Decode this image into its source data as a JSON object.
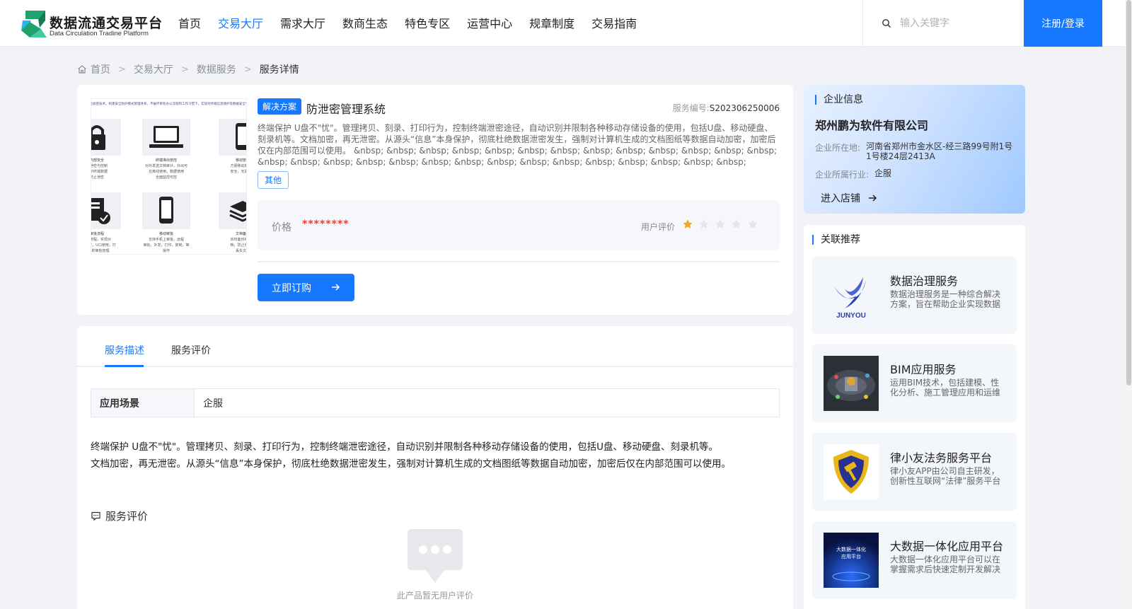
{
  "header": {
    "logo_cn": "数据流通交易平台",
    "logo_en": "Data Circulation Tradine Platform",
    "nav": [
      "首页",
      "交易大厅",
      "需求大厅",
      "数商生态",
      "特色专区",
      "运营中心",
      "规章制度",
      "交易指南"
    ],
    "active_nav": "交易大厅",
    "search_placeholder": "输入关键字",
    "login_label": "注册/登录",
    "accent_color": "#1677ff"
  },
  "breadcrumb": [
    "首页",
    "交易大厅",
    "数据服务",
    "服务详情"
  ],
  "product": {
    "tag": "解决方案",
    "title": "防泄密管理系统",
    "service_no_label": "服务编号:",
    "service_no": "S202306250006",
    "description": "终端保护 U盘不\"忧\"。管理拷贝、刻录、打印行为，控制终端泄密途径，自动识别并限制各种移动存储设备的使用，包括U盘、移动硬盘、刻录机等。文档加密，再无泄密。从源头“信息”本身保护，彻底杜绝数据泄密发生，强制对计算机生成的文档图纸等数据自动加密，加密后仅在内部范围可以使用。 &nbsp; &nbsp; &nbsp; &nbsp; &nbsp; &nbsp; &nbsp; &nbsp; &nbsp; &nbsp; &nbsp; &nbsp; &nbsp; &nbsp; &nbsp; &nbsp; &nbsp; &nbsp; &nbsp; &nbsp; &nbsp; &nbsp; &nbsp; &nbsp; &nbsp; &nbsp; &nbsp; &nbsp;",
    "category_tag": "其他",
    "price_label": "价格",
    "price": "********",
    "rating_label": "用户评价",
    "rating": 1,
    "rating_max": 5,
    "buy_label": "立即订购",
    "thumbnail": {
      "header_text": "融合加密技术，构建安全防护模式管理体系，不破坏原有办公流程和工作习惯下，实现对终端信息保护及数据安全管理",
      "cells": [
        {
          "icon": "lock-icon",
          "text": "内部安全\n防泄密与控制\n保护终端数据\n防止泄密"
        },
        {
          "icon": "laptop-icon",
          "text": "终端准出管控\n对外发送文档审计，外出可\n在离线使用，数据使用\n全面监控可控"
        },
        {
          "icon": "phone-icon",
          "text": "移动管理\n方便移动端办公\n安全，无需密码"
        },
        {
          "icon": "document-check-icon",
          "text": "审批流程\n审批流程，实现对\n文档外发，U口使用，打\n印等的审批管理"
        },
        {
          "icon": "phone-icon",
          "text": "移动审批\n支持手机上审批，远程\n审批，外发，打印，复制，等\n操作"
        },
        {
          "icon": "layers-icon",
          "text": "文档备份\n实时备份终端文\n档，防止误删或\n丢失文档"
        }
      ]
    }
  },
  "company": {
    "section_title": "企业信息",
    "name": "郑州鹏为软件有限公司",
    "location_label": "企业所在地:",
    "location": "河南省郑州市金水区-经三路99号附1号1号楼24层2413A",
    "industry_label": "企业所属行业:",
    "industry": "企服",
    "enter_store_label": "进入店铺"
  },
  "related": {
    "section_title": "关联推荐",
    "items": [
      {
        "title": "数据治理服务",
        "desc": "数据治理服务是一种综合解决方案，旨在帮助企业实现数据的有效管理",
        "image": "junyou-logo",
        "image_text": "JUNYOU"
      },
      {
        "title": "BIM应用服务",
        "desc": "运用BIM技术，包括建模、性化分析、施工管理应用和运维管理",
        "image": "bim-building-image",
        "image_text": ""
      },
      {
        "title": "律小友法务服务平台",
        "desc": "律小友APP由公司自主研发，创新性互联网“法律”服务平台",
        "image": "law-shield-logo",
        "image_text": ""
      },
      {
        "title": "大数据一体化应用平台",
        "desc": "大数据一体化应用平台可以在掌握需求后快速定制开发解决方案",
        "image": "bigdata-platform-image",
        "image_text": "大数据一体化\n应用平台"
      }
    ]
  },
  "detail": {
    "tabs": [
      "服务描述",
      "服务评价"
    ],
    "active_tab": "服务描述",
    "scene_label": "应用场景",
    "scene_value": "企服",
    "text_line1": "终端保护 U盘不\"忧\"。管理拷贝、刻录、打印行为，控制终端泄密途径，自动识别并限制各种移动存储设备的使用，包括U盘、移动硬盘、刻录机等。",
    "text_line2": "文档加密，再无泄密。从源头“信息”本身保护，彻底杜绝数据泄密发生，强制对计算机生成的文档图纸等数据自动加密，加密后仅在内部范围可以使用。",
    "review_title": "服务评价",
    "empty_text": "此产品暂无用户评价"
  }
}
